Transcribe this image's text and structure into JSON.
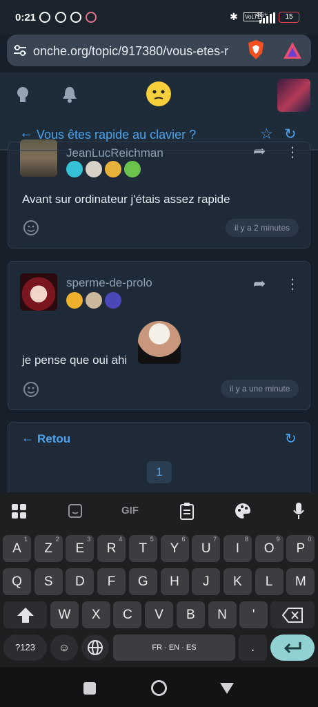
{
  "status_bar": {
    "time": "0:21",
    "battery": "15",
    "network": "4G+"
  },
  "browser": {
    "url": "onche.org/topic/917380/vous-etes-r"
  },
  "topic": {
    "title": "Vous êtes rapide au clavier ?"
  },
  "posts": [
    {
      "author": "JeanLucReichman",
      "text": "Avant sur ordinateur j'étais assez rapide",
      "time": "il y a 2 minutes"
    },
    {
      "author": "sperme-de-prolo",
      "text": "je pense que oui ahi",
      "time": "il y a une minute"
    }
  ],
  "footer_card": {
    "back_label": "Retou",
    "page": "1"
  },
  "keyboard": {
    "toolbar": [
      "apps-icon",
      "sticker-icon",
      "GIF",
      "clipboard-icon",
      "palette-icon",
      "mic-icon"
    ],
    "row1": [
      {
        "k": "A",
        "n": "1"
      },
      {
        "k": "Z",
        "n": "2"
      },
      {
        "k": "E",
        "n": "3"
      },
      {
        "k": "R",
        "n": "4"
      },
      {
        "k": "T",
        "n": "5"
      },
      {
        "k": "Y",
        "n": "6"
      },
      {
        "k": "U",
        "n": "7"
      },
      {
        "k": "I",
        "n": "8"
      },
      {
        "k": "O",
        "n": "9"
      },
      {
        "k": "P",
        "n": "0"
      }
    ],
    "row2": [
      "Q",
      "S",
      "D",
      "F",
      "G",
      "H",
      "J",
      "K",
      "L",
      "M"
    ],
    "row3": [
      "W",
      "X",
      "C",
      "V",
      "B",
      "N",
      "'"
    ],
    "symbols_label": "?123",
    "space_label": "FR · EN · ES",
    "period": "."
  }
}
